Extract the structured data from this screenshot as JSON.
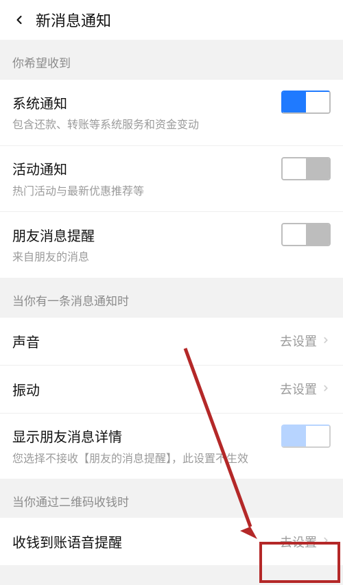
{
  "header": {
    "title": "新消息通知"
  },
  "sections": {
    "want": {
      "header": "你希望收到",
      "items": {
        "system": {
          "title": "系统通知",
          "sub": "包含还款、转账等系统服务和资金变动"
        },
        "activity": {
          "title": "活动通知",
          "sub": "热门活动与最新优惠推荐等"
        },
        "friend": {
          "title": "朋友消息提醒",
          "sub": "来自朋友的消息"
        }
      }
    },
    "whenMsg": {
      "header": "当你有一条消息通知时",
      "sound": {
        "title": "声音",
        "action": "去设置"
      },
      "vibrate": {
        "title": "振动",
        "action": "去设置"
      },
      "detail": {
        "title": "显示朋友消息详情",
        "sub": "您选择不接收【朋友的消息提醒】，此设置不生效"
      }
    },
    "qr": {
      "header": "当你通过二维码收钱时",
      "voice": {
        "title": "收钱到账语音提醒",
        "action": "去设置"
      }
    }
  }
}
